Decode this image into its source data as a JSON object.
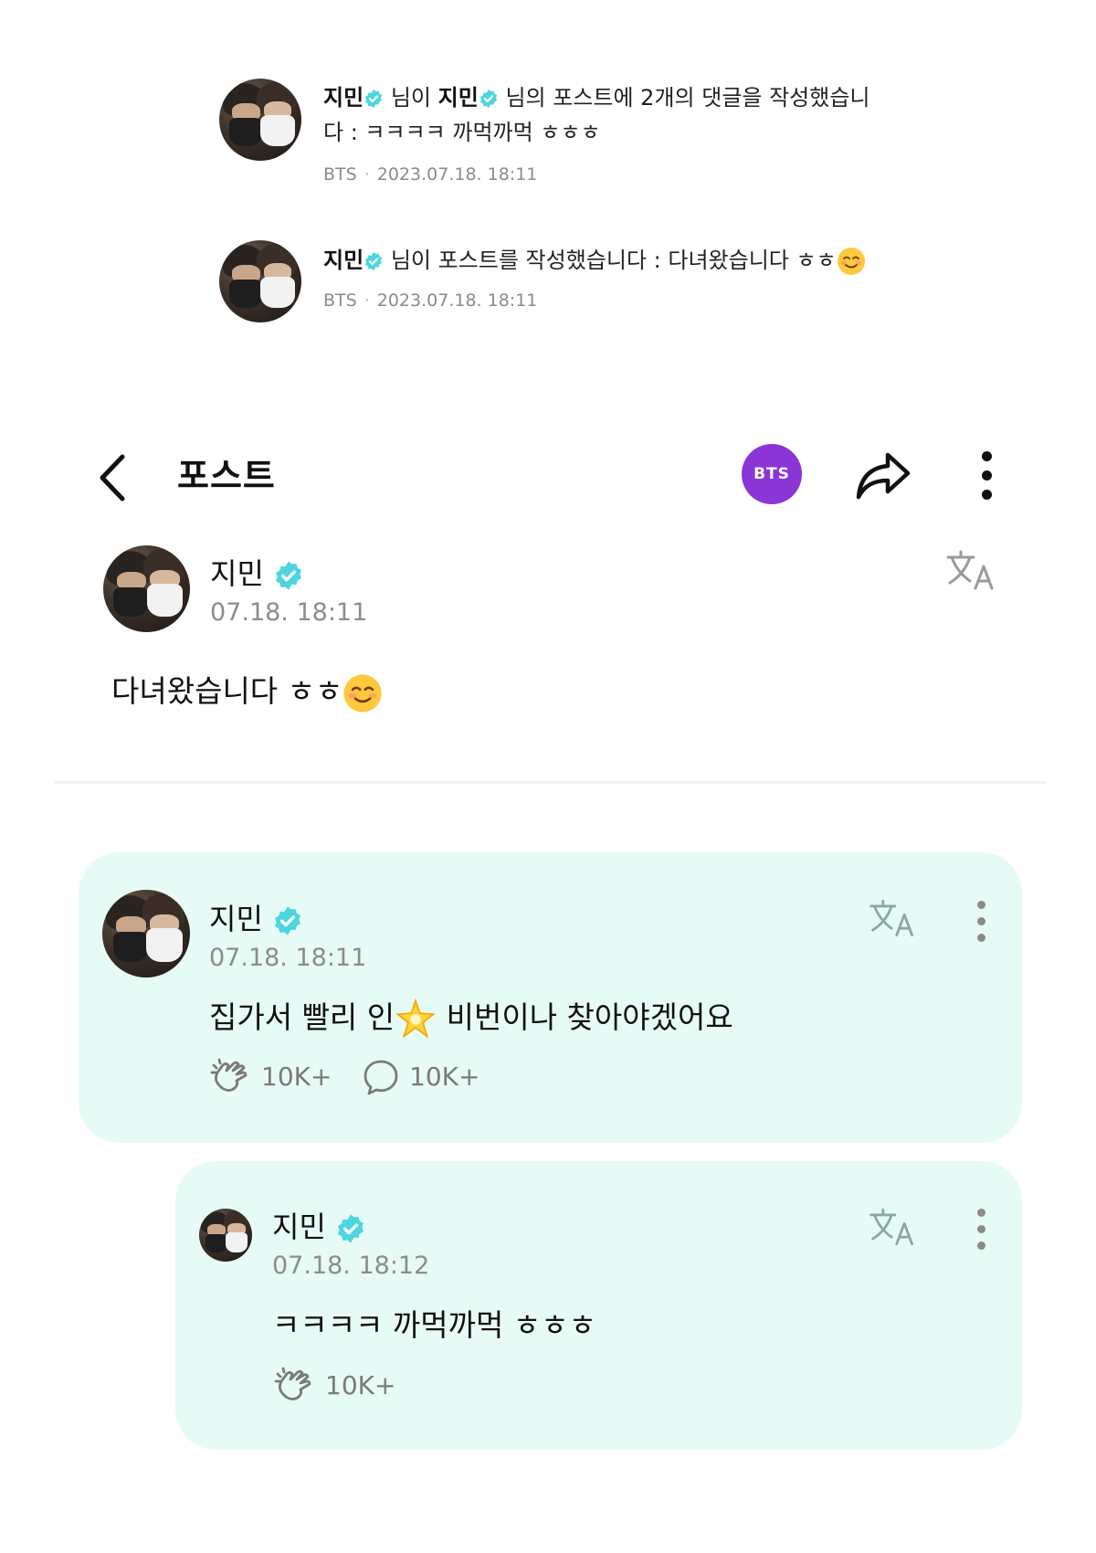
{
  "notifications": [
    {
      "user": "지민",
      "text_1": "님이",
      "target_user": "지민",
      "text_2": "님의 포스트에 2개의 댓글을 작성했습니",
      "text_3": "다 : ㅋㅋㅋㅋ 까먹까먹 ㅎㅎㅎ",
      "community": "BTS",
      "separator": "·",
      "timestamp": "2023.07.18. 18:11"
    },
    {
      "user": "지민",
      "text_1": "님이 포스트를 작성했습니다 : 다녀왔습니다 ㅎㅎ",
      "community": "BTS",
      "separator": "·",
      "timestamp": "2023.07.18. 18:11"
    }
  ],
  "header": {
    "back_icon": "chevron-left-icon",
    "title": "포스트",
    "community_chip": "BTS",
    "chip_color": "#8b35d6",
    "share_icon": "share-arrow-icon",
    "more_icon": "more-vertical-icon"
  },
  "post": {
    "author": "지민",
    "time": "07.18. 18:11",
    "body": "다녀왔습니다 ㅎㅎ",
    "translate_icon": "translate-icon"
  },
  "comments": [
    {
      "author": "지민",
      "time": "07.18. 18:11",
      "body_1": "집가서 빨리 인",
      "body_2": " 비번이나 찾아야겠어요",
      "like_count": "10K+",
      "reply_count": "10K+"
    },
    {
      "author": "지민",
      "time": "07.18. 18:12",
      "body": "ㅋㅋㅋㅋ 까먹까먹 ㅎㅎㅎ",
      "like_count": "10K+"
    }
  ],
  "colors": {
    "verified": "#4dd6e0",
    "card_bg": "#e7fbf6",
    "accent_purple": "#8b35d6"
  }
}
